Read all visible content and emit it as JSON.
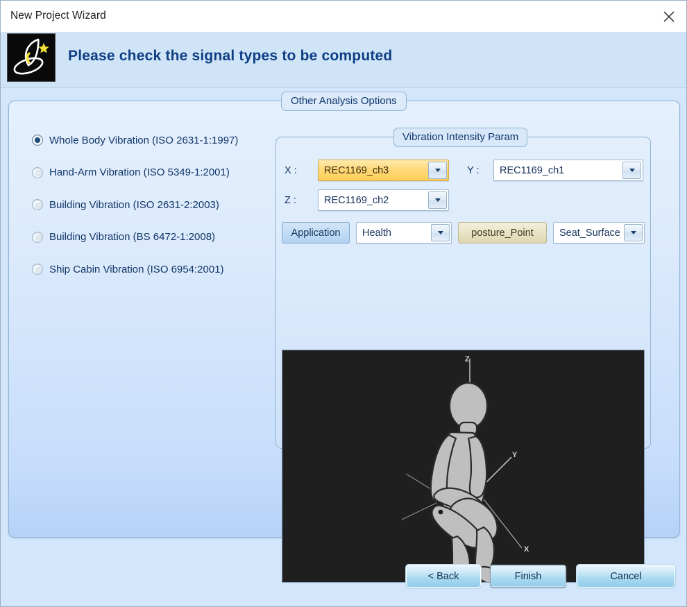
{
  "window": {
    "title": "New Project Wizard",
    "close_icon": "close-icon"
  },
  "header": {
    "title": "Please check the signal types to be computed",
    "icon": "wizard-hat-icon"
  },
  "content": {
    "other_analysis_legend": "Other Analysis Options"
  },
  "signal_types": {
    "options": [
      {
        "label": "Whole Body Vibration (ISO 2631-1:1997)",
        "selected": true
      },
      {
        "label": "Hand-Arm Vibration (ISO 5349-1:2001)",
        "selected": false
      },
      {
        "label": "Building Vibration (ISO 2631-2:2003)",
        "selected": false
      },
      {
        "label": "Building Vibration (BS 6472-1:2008)",
        "selected": false
      },
      {
        "label": "Ship Cabin Vibration (ISO 6954:2001)",
        "selected": false
      }
    ]
  },
  "vibration_intensity": {
    "legend": "Vibration Intensity Param",
    "x_label": "X :",
    "x_value": "REC1169_ch3",
    "y_label": "Y :",
    "y_value": "REC1169_ch1",
    "z_label": "Z :",
    "z_value": "REC1169_ch2",
    "application_button": "Application",
    "application_value": "Health",
    "posture_button": "posture_Point",
    "posture_value": "Seat_Surface"
  },
  "preview": {
    "axis_z": "Z",
    "axis_y": "Y",
    "axis_x": "X",
    "figure": "seated-human-figure"
  },
  "footer": {
    "back": "< Back",
    "finish": "Finish",
    "cancel": "Cancel"
  },
  "colors": {
    "header_bg": "#cfe4f7",
    "header_text": "#0f3f85",
    "body_bg": "#d3e6fb",
    "highlight_field": "#ffd873",
    "tan_button": "#e8e3c6",
    "preview_bg": "#201f1f"
  }
}
